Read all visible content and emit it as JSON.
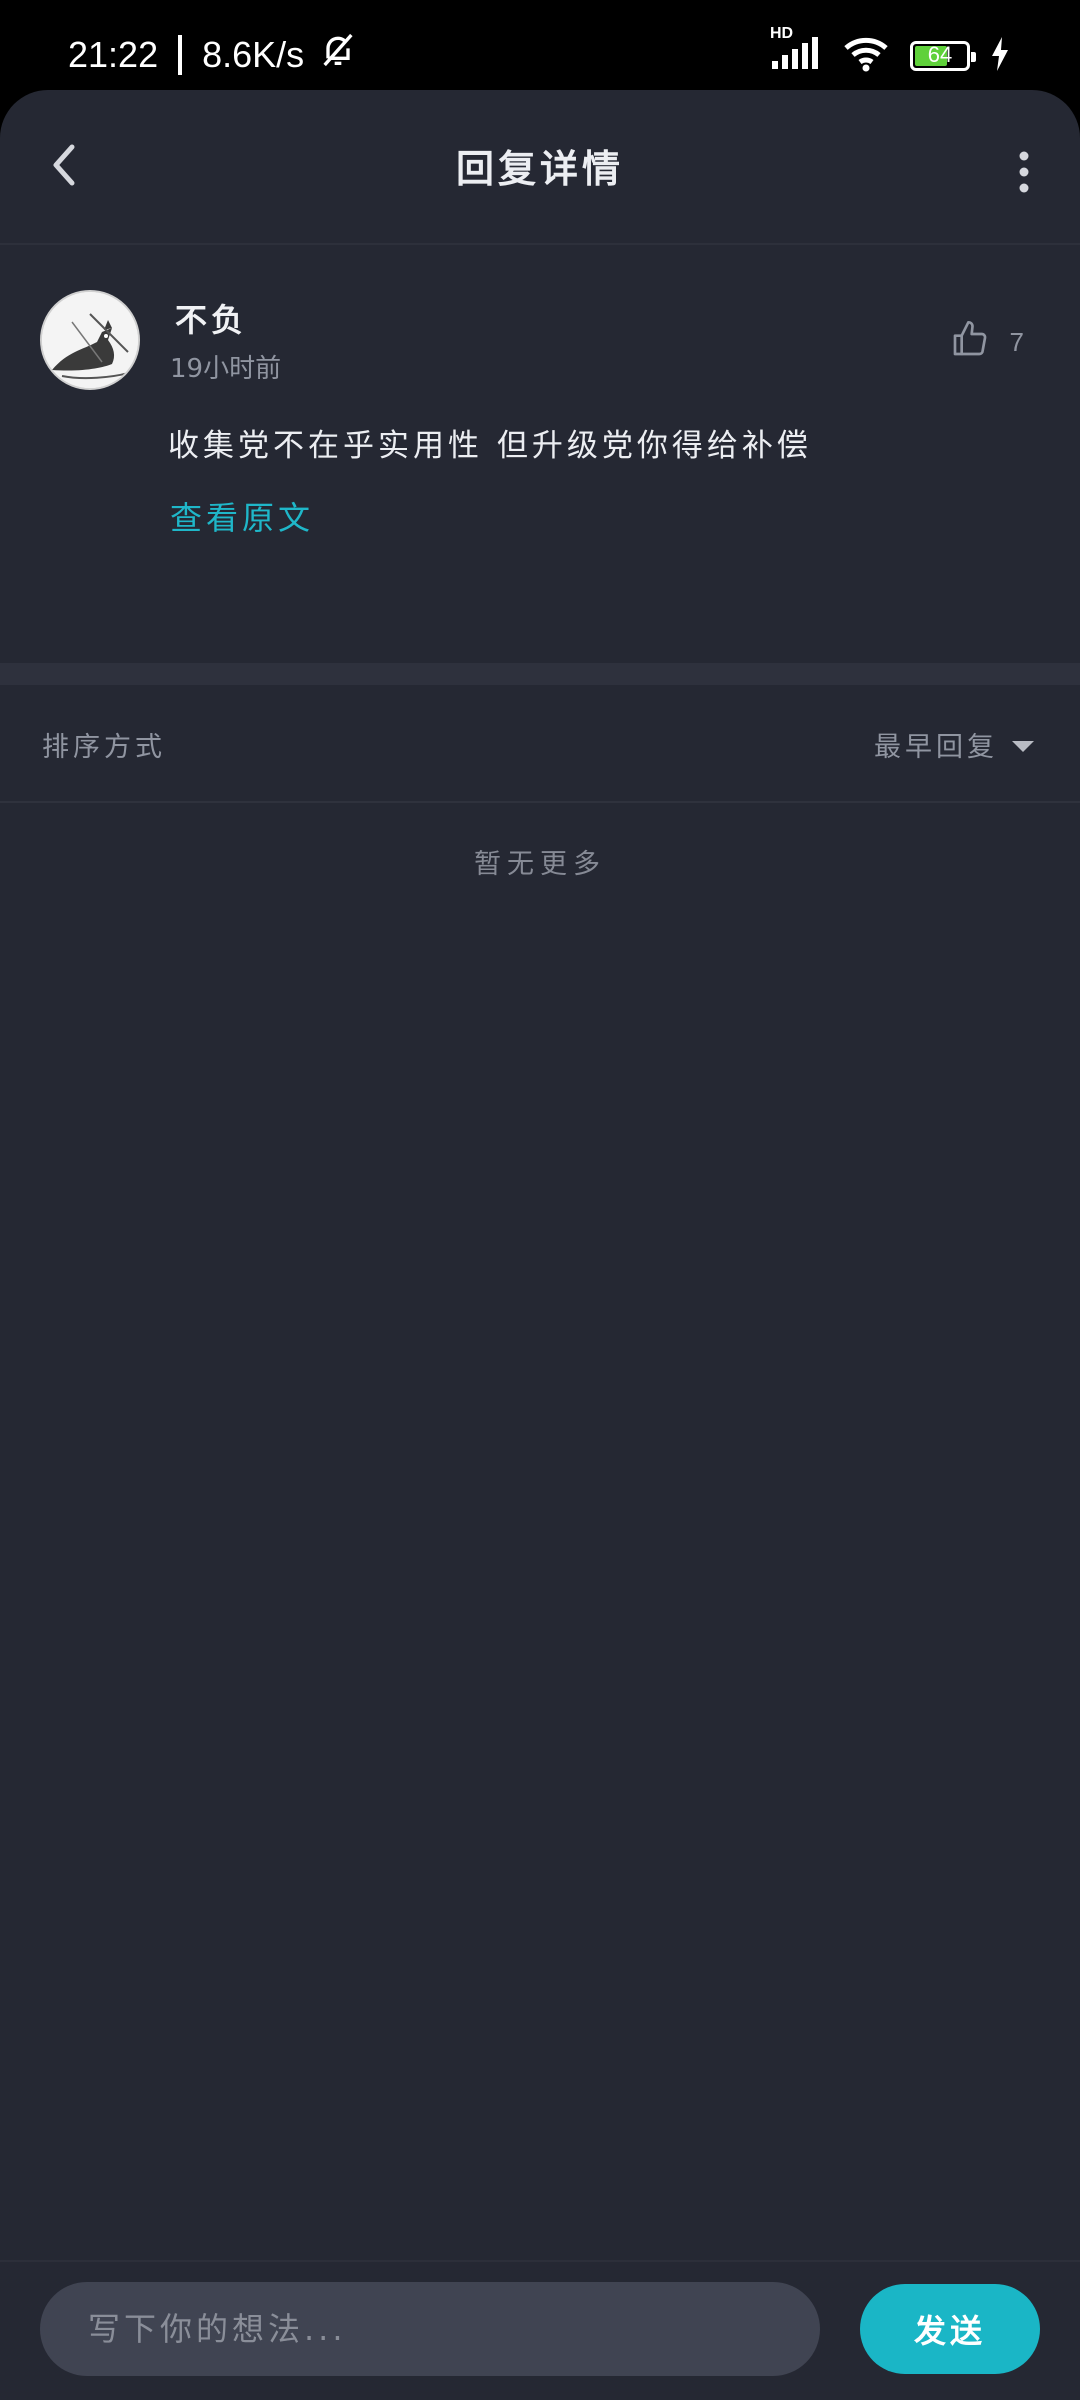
{
  "status_bar": {
    "time": "21:22",
    "net_speed": "8.6K/s",
    "network_badge": "HD",
    "battery_level": "64",
    "battery_fraction": 0.64,
    "icons": [
      "mute-bell-icon",
      "signal-icon",
      "wifi-icon",
      "battery-icon",
      "charging-icon"
    ]
  },
  "header": {
    "title": "回复详情",
    "icons": [
      "back-arrow-icon",
      "more-vertical-icon"
    ]
  },
  "comment": {
    "username": "不负",
    "time_ago": "19小时前",
    "content": "收集党不在乎实用性 但升级党你得给补偿",
    "view_original": "查看原文",
    "like_count": "7",
    "icons": [
      "thumbs-up-icon",
      "avatar-image"
    ]
  },
  "sort": {
    "label": "排序方式",
    "selected": "最早回复",
    "icon": "caret-down-icon"
  },
  "list": {
    "empty_text": "暂无更多"
  },
  "composer": {
    "placeholder": "写下你的想法...",
    "send_label": "发送"
  },
  "colors": {
    "background": "#252833",
    "accent": "#1ab6c6",
    "muted_text": "#9095a1",
    "primary_text": "#eceef2"
  }
}
